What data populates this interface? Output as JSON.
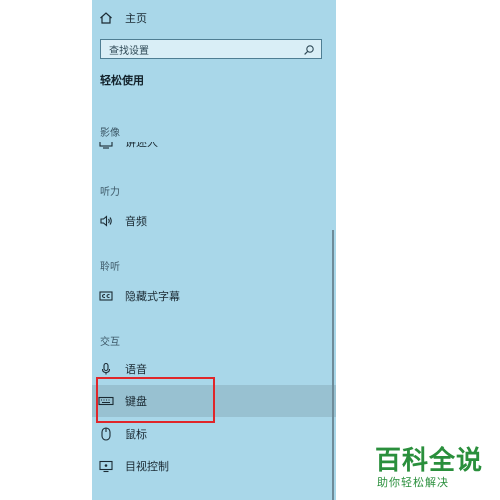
{
  "nav": {
    "home_label": "主页",
    "search_placeholder": "查找设置",
    "page_title": "轻松使用"
  },
  "sections": {
    "vision": "影像",
    "hearing": "听力",
    "listening": "聆听",
    "interaction": "交互"
  },
  "items": {
    "narrator_partial": "讲述人",
    "audio": "音频",
    "captions": "隐藏式字幕",
    "speech": "语音",
    "keyboard": "键盘",
    "mouse": "鼠标",
    "eye_control": "目视控制"
  },
  "watermark": {
    "title": "百科全说",
    "subtitle": "助你轻松解决"
  },
  "colors": {
    "panel_bg": "#a9d7e9",
    "selected_bg": "#98c1d1",
    "annotation_red": "#e0262a",
    "watermark_green": "#2a8f3c"
  },
  "icons": {
    "home": "home-icon",
    "search": "search-icon",
    "narrator": "narrator-icon",
    "audio": "speaker-icon",
    "captions": "closed-captions-icon",
    "speech": "microphone-icon",
    "keyboard": "keyboard-icon",
    "mouse": "mouse-icon",
    "eye_control": "eye-control-icon"
  }
}
